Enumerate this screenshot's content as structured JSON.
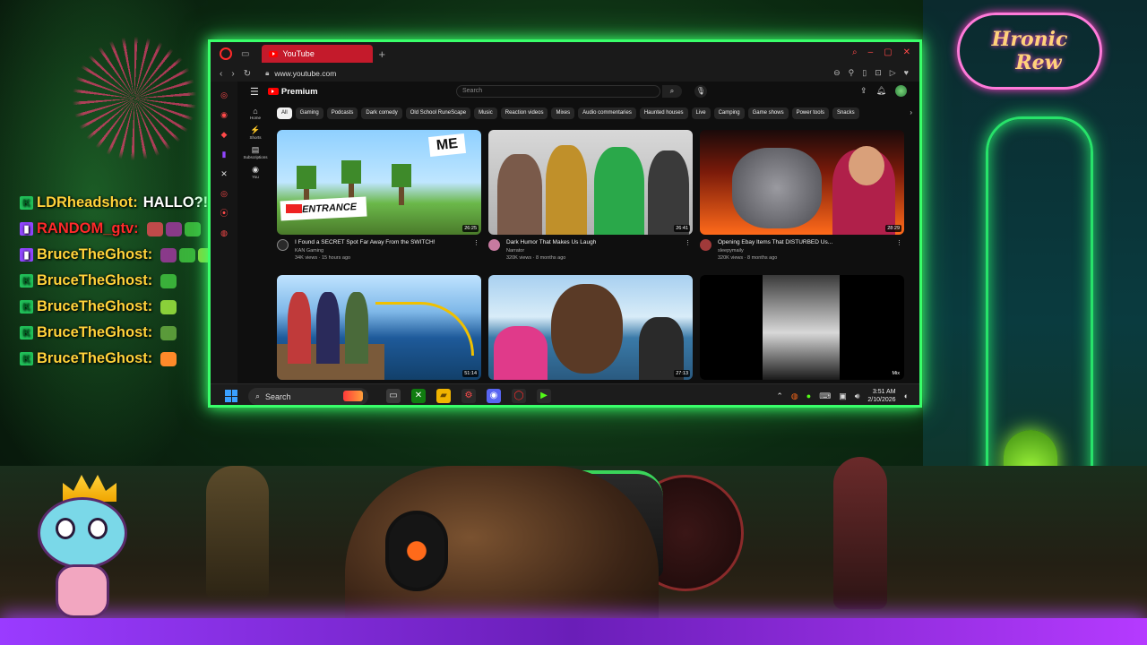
{
  "stream": {
    "logo_line1": "Hronic",
    "logo_line2": "Rew"
  },
  "chat": [
    {
      "badge": "kick",
      "user": "LDRheadshot",
      "user_color": "#ffd23a",
      "message": "HALLO?!"
    },
    {
      "badge": "twitch",
      "user": "RANDOM_gtv",
      "user_color": "#ff2a2a",
      "message": ""
    },
    {
      "badge": "twitch",
      "user": "BruceTheGhost",
      "user_color": "#ffd23a",
      "message": ""
    },
    {
      "badge": "kick",
      "user": "BruceTheGhost",
      "user_color": "#ffd23a",
      "message": ""
    },
    {
      "badge": "kick",
      "user": "BruceTheGhost",
      "user_color": "#ffd23a",
      "message": ""
    },
    {
      "badge": "kick",
      "user": "BruceTheGhost",
      "user_color": "#ffd23a",
      "message": ""
    },
    {
      "badge": "kick",
      "user": "BruceTheGhost",
      "user_color": "#ffd23a",
      "message": ""
    }
  ],
  "browser": {
    "tab_title": "YouTube",
    "url": "www.youtube.com",
    "accent": "#c41a2b"
  },
  "youtube": {
    "logo_text": "Premium",
    "search_placeholder": "Search",
    "guide": [
      {
        "icon": "home-icon",
        "glyph": "⌂",
        "label": "Home"
      },
      {
        "icon": "shorts-icon",
        "glyph": "⚡",
        "label": "Shorts"
      },
      {
        "icon": "subscriptions-icon",
        "glyph": "▤",
        "label": "Subscriptions"
      },
      {
        "icon": "you-icon",
        "glyph": "◉",
        "label": "You"
      }
    ],
    "chips": [
      "All",
      "Gaming",
      "Podcasts",
      "Dark comedy",
      "Old School RuneScape",
      "Music",
      "Reaction videos",
      "Mixes",
      "Audio commentaries",
      "Haunted houses",
      "Live",
      "Camping",
      "Game shows",
      "Power tools",
      "Snacks"
    ],
    "videos": [
      {
        "title": "I Found a SECRET Spot Far Away From the SWITCH!",
        "channel": "KAN Gaming",
        "stats": "34K views · 15 hours ago",
        "duration": "26:25",
        "thumb_text_1": "ME",
        "thumb_text_2": "ENTRANCE",
        "avatar_color": "#2a2a2a"
      },
      {
        "title": "Dark Humor That Makes Us Laugh",
        "channel": "Narrator",
        "stats": "320K views · 8 months ago",
        "duration": "26:41",
        "avatar_color": "#c77aa0"
      },
      {
        "title": "Opening Ebay Items That DISTURBED Us...",
        "channel": "sleepymaily",
        "stats": "320K views · 8 months ago",
        "duration": "28:29",
        "avatar_color": "#a03a3a"
      },
      {
        "title": "",
        "channel": "",
        "stats": "",
        "duration": "51:14"
      },
      {
        "title": "",
        "channel": "",
        "stats": "",
        "duration": "27:13"
      },
      {
        "title": "",
        "channel": "",
        "stats": "",
        "duration": "Mix"
      }
    ]
  },
  "taskbar": {
    "search_label": "Search",
    "time": "3:51 AM",
    "date": "2/10/2026"
  }
}
